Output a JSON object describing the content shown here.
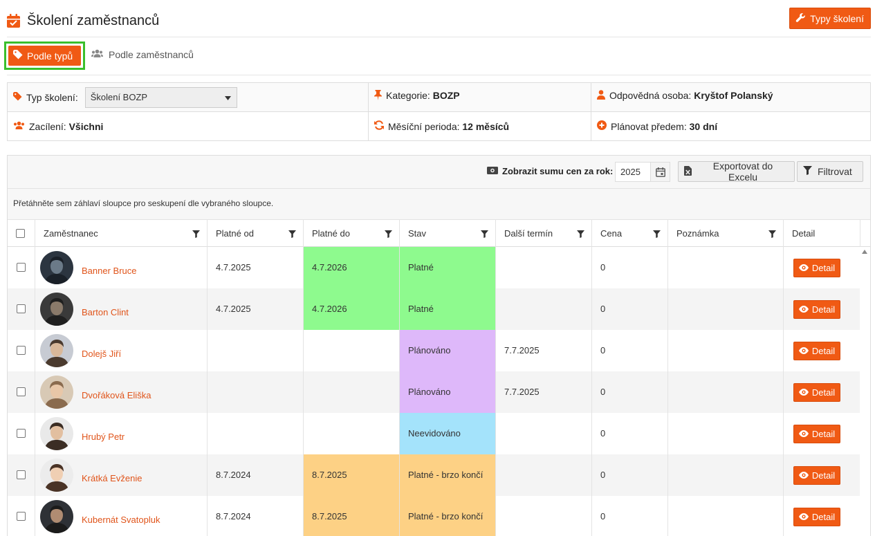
{
  "header": {
    "title": "Školení zaměstnanců",
    "types_button": "Typy školení"
  },
  "tabs": [
    {
      "label": "Podle typů",
      "active": true
    },
    {
      "label": "Podle zaměstnanců",
      "active": false
    }
  ],
  "info": {
    "type_label": "Typ školení:",
    "type_value": "Školení BOZP",
    "category_label": "Kategorie:",
    "category_value": "BOZP",
    "responsible_label": "Odpovědná osoba:",
    "responsible_value": "Kryštof Polanský",
    "target_label": "Zacílení:",
    "target_value": "Všichni",
    "period_label": "Měsíční perioda:",
    "period_value": "12 měsíců",
    "plan_label": "Plánovat předem:",
    "plan_value": "30 dní"
  },
  "toolbar": {
    "sum_label": "Zobrazit sumu cen za rok:",
    "year": "2025",
    "export_label": "Exportovat do Excelu",
    "filter_label": "Filtrovat"
  },
  "group_hint": "Přetáhněte sem záhlaví sloupce pro seskupení dle vybraného sloupce.",
  "columns": {
    "employee": "Zaměstnanec",
    "valid_from": "Platné od",
    "valid_to": "Platné do",
    "status": "Stav",
    "next_date": "Další termín",
    "price": "Cena",
    "note": "Poznámka",
    "detail": "Detail"
  },
  "rows": [
    {
      "name": "Banner Bruce",
      "from": "4.7.2025",
      "to": "4.7.2026",
      "status": "Platné",
      "next": "",
      "price": "0",
      "note": "",
      "detail": "Detail"
    },
    {
      "name": "Barton Clint",
      "from": "4.7.2025",
      "to": "4.7.2026",
      "status": "Platné",
      "next": "",
      "price": "0",
      "note": "",
      "detail": "Detail"
    },
    {
      "name": "Dolejš Jiří",
      "from": "",
      "to": "",
      "status": "Plánováno",
      "next": "7.7.2025",
      "price": "0",
      "note": "",
      "detail": "Detail"
    },
    {
      "name": "Dvořáková Eliška",
      "from": "",
      "to": "",
      "status": "Plánováno",
      "next": "7.7.2025",
      "price": "0",
      "note": "",
      "detail": "Detail"
    },
    {
      "name": "Hrubý Petr",
      "from": "",
      "to": "",
      "status": "Neevidováno",
      "next": "",
      "price": "0",
      "note": "",
      "detail": "Detail"
    },
    {
      "name": "Krátká Evženie",
      "from": "8.7.2024",
      "to": "8.7.2025",
      "status": "Platné - brzo končí",
      "next": "",
      "price": "0",
      "note": "",
      "detail": "Detail"
    },
    {
      "name": "Kubernát Svatopluk",
      "from": "8.7.2024",
      "to": "8.7.2025",
      "status": "Platné - brzo končí",
      "next": "",
      "price": "0",
      "note": "",
      "detail": "Detail"
    }
  ],
  "colors": {
    "accent": "#f05a14",
    "valid": "#8efa8e",
    "planned": "#deb8fa",
    "unrecorded": "#a4e3fb",
    "expiring": "#fdd185"
  }
}
